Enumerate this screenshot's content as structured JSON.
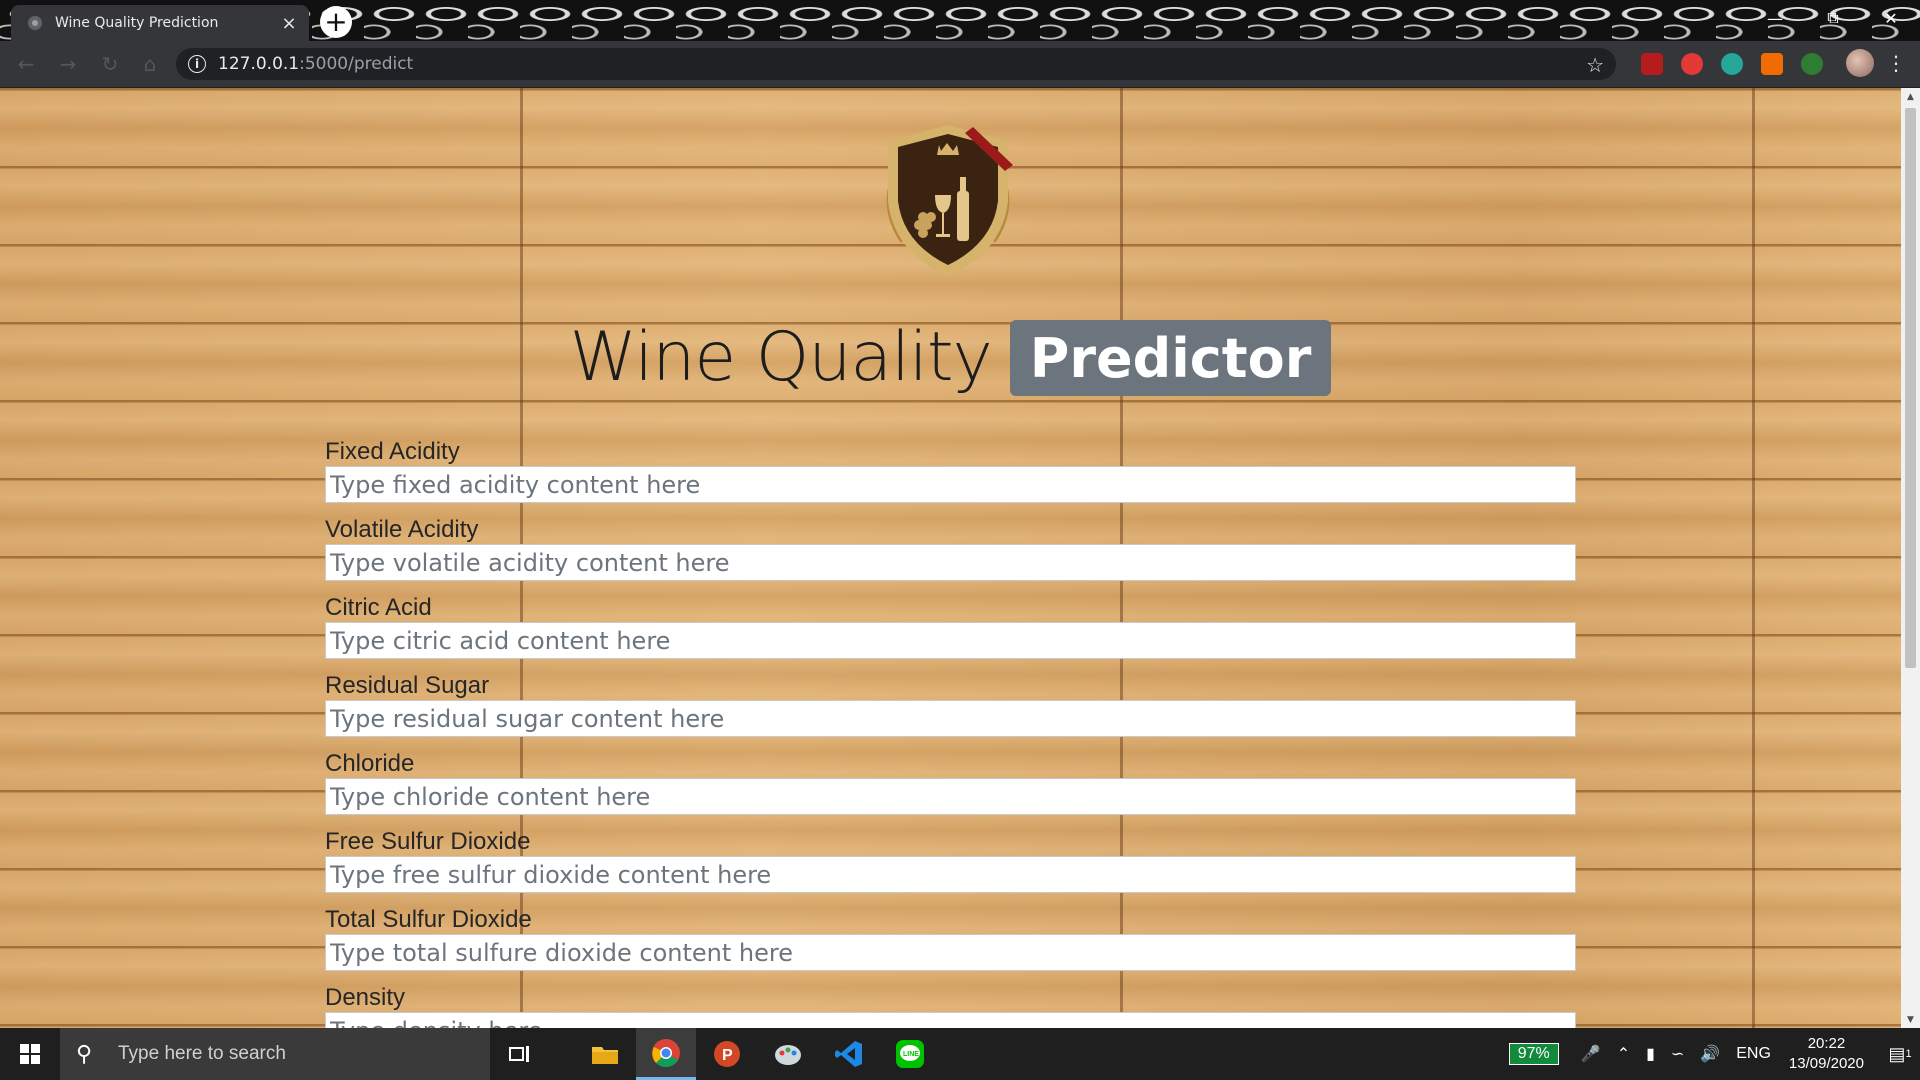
{
  "browser": {
    "tab_title": "Wine Quality Prediction",
    "tab_close": "×",
    "new_tab": "+",
    "url_host": "127.0.0.1",
    "url_path": ":5000/predict"
  },
  "page": {
    "heading_main": "Wine Quality",
    "heading_badge": "Predictor",
    "fields": [
      {
        "label": "Fixed Acidity",
        "placeholder": "Type fixed acidity content here"
      },
      {
        "label": "Volatile Acidity",
        "placeholder": "Type volatile acidity content here"
      },
      {
        "label": "Citric Acid",
        "placeholder": "Type citric acid content here"
      },
      {
        "label": "Residual Sugar",
        "placeholder": "Type residual sugar content here"
      },
      {
        "label": "Chloride",
        "placeholder": "Type chloride content here"
      },
      {
        "label": "Free Sulfur Dioxide",
        "placeholder": "Type free sulfur dioxide content here"
      },
      {
        "label": "Total Sulfur Dioxide",
        "placeholder": "Type total sulfure dioxide content here"
      },
      {
        "label": "Density",
        "placeholder": "Type density here"
      }
    ]
  },
  "taskbar": {
    "search_placeholder": "Type here to search",
    "battery": "97%",
    "language": "ENG",
    "time": "20:22",
    "date": "13/09/2020",
    "notification_count": "1"
  },
  "colors": {
    "badge": "#6c757d",
    "wood": "#d9a86a",
    "taskbar": "#1f1f1f"
  }
}
